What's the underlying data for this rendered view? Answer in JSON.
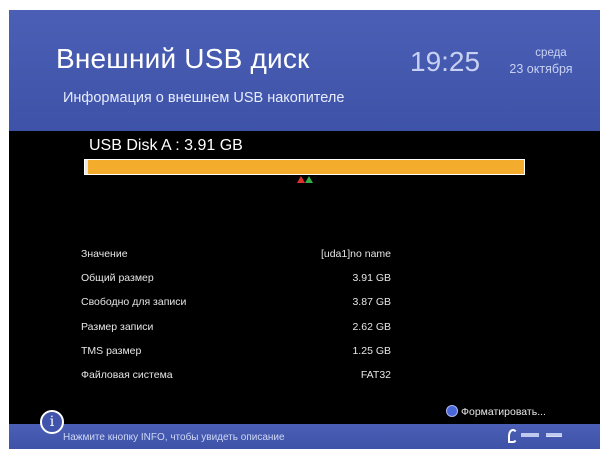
{
  "header": {
    "title": "Внешний USB диск",
    "subtitle": "Информация о внешнем USB накопителе",
    "time": "19:25",
    "day": "среда",
    "date": "23 октября"
  },
  "disk": {
    "label": "USB Disk A : 3.91 GB",
    "used_fraction": 0.01
  },
  "info_rows": [
    {
      "key": "Значение",
      "value": "[uda1]no name"
    },
    {
      "key": "Общий размер",
      "value": "3.91 GB"
    },
    {
      "key": "Свободно для записи",
      "value": "3.87 GB"
    },
    {
      "key": "Размер записи",
      "value": "2.62 GB"
    },
    {
      "key": "TMS размер",
      "value": "1.25 GB"
    },
    {
      "key": "Файловая система",
      "value": "FAT32"
    }
  ],
  "footer": {
    "format_label": "Форматировать...",
    "hint": "Нажмите кнопку INFO, чтобы увидеть описание",
    "info_icon": "i"
  },
  "colors": {
    "header_bg": "#4a5fb5",
    "bar_fill": "#f3ac2b",
    "marker_red": "#e03030",
    "marker_green": "#33b04a",
    "format_button": "#4868d8"
  },
  "icons": {
    "info": "info-icon",
    "format": "blue-button-icon",
    "logo": "operator-logo"
  }
}
